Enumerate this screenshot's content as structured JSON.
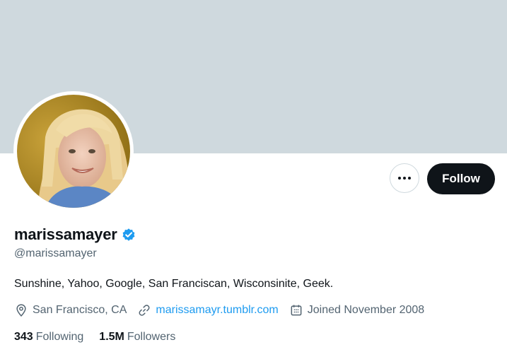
{
  "profile": {
    "display_name": "marissamayer",
    "handle": "@marissamayer",
    "bio": "Sunshine, Yahoo, Google, San Franciscan, Wisconsinite, Geek.",
    "location": "San Francisco, CA",
    "website": "marissamayr.tumblr.com",
    "joined": "Joined November 2008",
    "verified": true
  },
  "actions": {
    "follow_label": "Follow",
    "more_icon": "ellipsis-icon"
  },
  "stats": {
    "following_count": "343",
    "following_label": "Following",
    "followers_count": "1.5M",
    "followers_label": "Followers"
  },
  "colors": {
    "banner": "#cfd9de",
    "accent": "#1d9bf0",
    "text_primary": "#0f1419",
    "text_secondary": "#536471",
    "follow_button": "#0f1419"
  }
}
